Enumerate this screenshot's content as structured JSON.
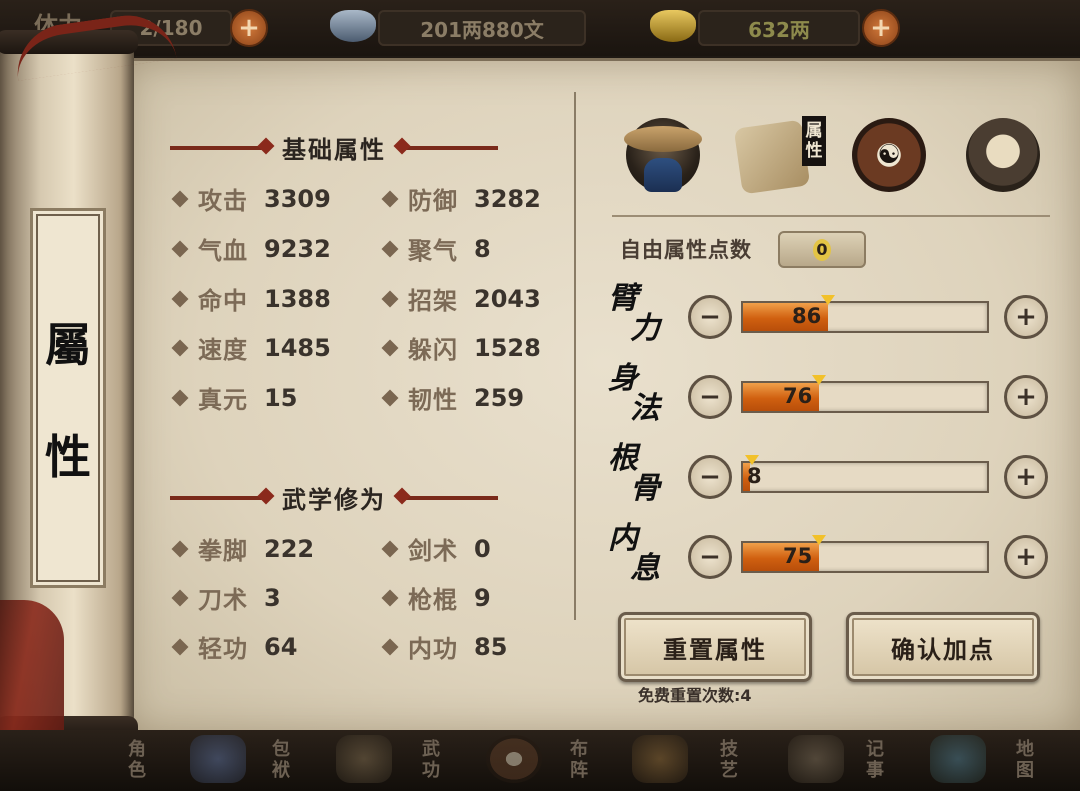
{
  "topbar": {
    "stamina_label": "体力",
    "stamina_value": "2/180",
    "money": "201两880文",
    "gold": "632两"
  },
  "title": {
    "char1": "屬",
    "char2": "性"
  },
  "basic": {
    "heading": "基础属性",
    "stats": [
      {
        "label": "攻击",
        "value": "3309"
      },
      {
        "label": "防御",
        "value": "3282"
      },
      {
        "label": "气血",
        "value": "9232"
      },
      {
        "label": "聚气",
        "value": "8"
      },
      {
        "label": "命中",
        "value": "1388"
      },
      {
        "label": "招架",
        "value": "2043"
      },
      {
        "label": "速度",
        "value": "1485"
      },
      {
        "label": "躲闪",
        "value": "1528"
      },
      {
        "label": "真元",
        "value": "15"
      },
      {
        "label": "韧性",
        "value": "259"
      }
    ]
  },
  "martial": {
    "heading": "武学修为",
    "stats": [
      {
        "label": "拳脚",
        "value": "222"
      },
      {
        "label": "剑术",
        "value": "0"
      },
      {
        "label": "刀术",
        "value": "3"
      },
      {
        "label": "枪棍",
        "value": "9"
      },
      {
        "label": "轻功",
        "value": "64"
      },
      {
        "label": "内功",
        "value": "85"
      }
    ]
  },
  "tabs": {
    "active_label_1": "属",
    "active_label_2": "性",
    "icons": [
      "hero-portrait-icon",
      "scroll-icon",
      "bagua-icon",
      "meridian-body-icon"
    ]
  },
  "points": {
    "free_label": "自由属性点数",
    "free_value": "0",
    "minus": "−",
    "plus": "+",
    "attrs": [
      {
        "name1": "臂",
        "name2": "力",
        "value": "86",
        "level": 0.35
      },
      {
        "name1": "身",
        "name2": "法",
        "value": "76",
        "level": 0.31
      },
      {
        "name1": "根",
        "name2": "骨",
        "value": "8",
        "level": 0.03
      },
      {
        "name1": "内",
        "name2": "息",
        "value": "75",
        "level": 0.31
      }
    ]
  },
  "actions": {
    "reset": "重置属性",
    "confirm": "确认加点",
    "reset_count": "免费重置次数:4"
  },
  "bottomnav": {
    "items": [
      {
        "l1": "角",
        "l2": "色"
      },
      {
        "l1": "包",
        "l2": "袱"
      },
      {
        "l1": "武",
        "l2": "功"
      },
      {
        "l1": "布",
        "l2": "阵"
      },
      {
        "l1": "技",
        "l2": "艺"
      },
      {
        "l1": "记",
        "l2": "事"
      },
      {
        "l1": "地",
        "l2": "图"
      }
    ]
  },
  "colors": {
    "accent": "#d06010",
    "paper": "#e2d8c2",
    "ornament": "#8b2a1c"
  }
}
